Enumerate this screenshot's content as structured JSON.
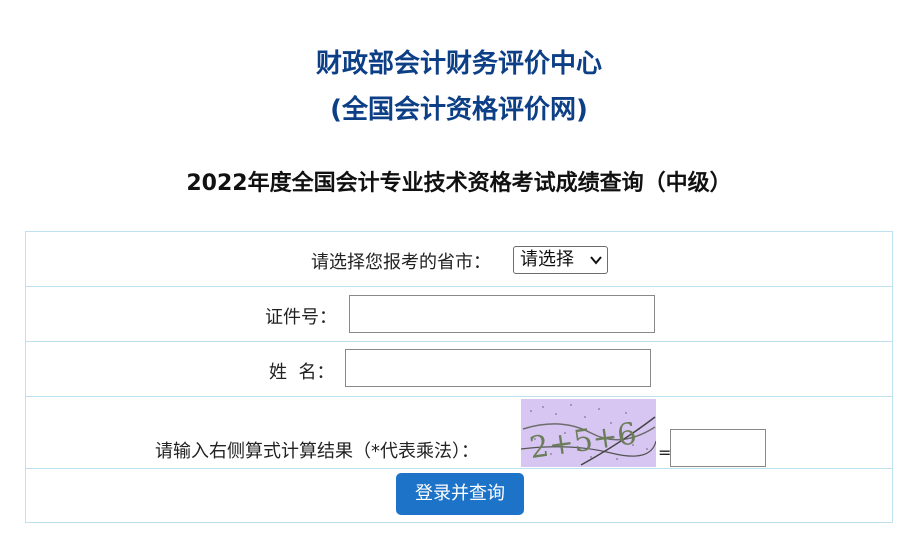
{
  "header": {
    "org_line1": "财政部会计财务评价中心",
    "org_line2": "(全国会计资格评价网)",
    "exam_title": "2022年度全国会计专业技术资格考试成绩查询（中级）"
  },
  "form": {
    "province_label": "请选择您报考的省市：",
    "province_selected": "请选择",
    "id_label": "证件号：",
    "id_value": "",
    "name_label": "姓  名：",
    "name_value": "",
    "captcha_label": "请输入右侧算式计算结果（*代表乘法）：",
    "captcha_image_text": "2+5+6",
    "equals": "=",
    "captcha_answer": "",
    "submit_label": "登录并查询"
  },
  "colors": {
    "title_blue": "#0d3f86",
    "border": "#bfe0ee",
    "button": "#1c73c8"
  },
  "icons": {
    "select_chevron": "chevron-down-icon"
  }
}
